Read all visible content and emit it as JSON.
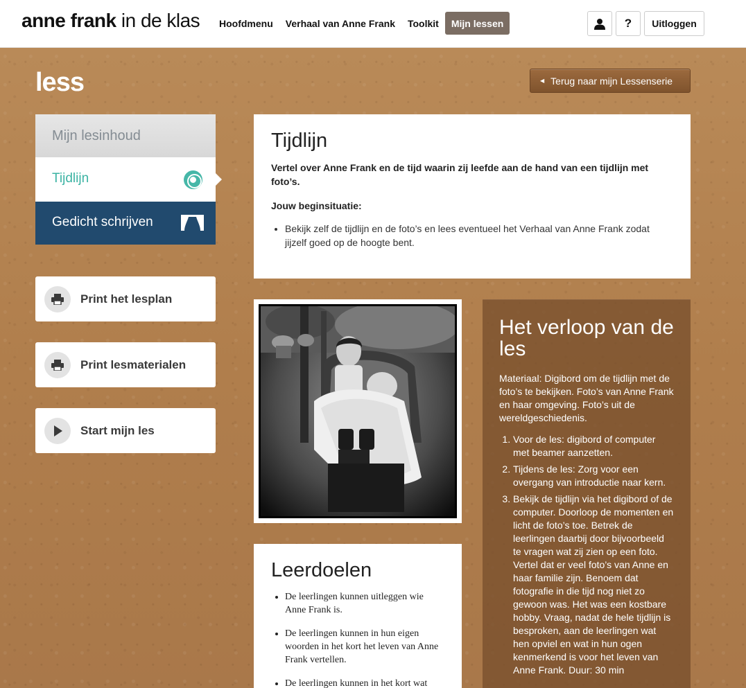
{
  "header": {
    "logo_bold": "anne frank",
    "logo_regular": "in de klas",
    "nav": [
      "Hoofdmenu",
      "Verhaal van Anne Frank",
      "Toolkit",
      "Mijn lessen"
    ],
    "user_icon": "user-icon",
    "help_label": "?",
    "logout_label": "Uitloggen"
  },
  "page": {
    "title": "less",
    "back_label": "Terug naar mijn Lessenserie"
  },
  "sidebar": {
    "heading": "Mijn lesinhoud",
    "items": [
      {
        "label": "Tijdlijn",
        "icon": "target-icon"
      },
      {
        "label": "Gedicht schrijven",
        "icon": "curtain-icon"
      }
    ],
    "actions": [
      {
        "label": "Print het lesplan",
        "icon": "printer-icon"
      },
      {
        "label": "Print lesmaterialen",
        "icon": "printer-icon"
      },
      {
        "label": "Start mijn les",
        "icon": "play-icon"
      }
    ]
  },
  "intro": {
    "title": "Tijdlijn",
    "lead": "Vertel over Anne Frank en de tijd waarin zij leefde aan de hand van een tijdlijn met foto’s.",
    "subheading": "Jouw beginsituatie:",
    "bullets": [
      "Bekijk zelf de tijdlijn en de foto’s en lees eventueel het Verhaal van Anne Frank zodat jijzelf goed op de hoogte bent."
    ]
  },
  "goals": {
    "title": "Leerdoelen",
    "items": [
      "De leerlingen kunnen uitleggen wie Anne Frank is.",
      "De leerlingen kunnen in hun eigen woorden in het kort het leven van Anne Frank vertellen.",
      "De leerlingen kunnen in het kort wat"
    ]
  },
  "course": {
    "title": "Het verloop van de les",
    "material": "Materiaal: Digibord om de tijdlijn met de foto’s te bekijken. Foto’s van Anne Frank en haar omgeving. Foto’s uit de wereldgeschiedenis.",
    "steps": [
      "Voor de les: digibord of computer met beamer aanzetten.",
      "Tijdens de les: Zorg voor een overgang van introductie naar kern.",
      "Bekijk de tijdlijn via het digibord of de computer. Doorloop de momenten en licht de foto’s toe. Betrek de leerlingen daarbij door bijvoorbeeld te vragen wat zij zien op een foto. Vertel dat er veel foto’s van Anne en haar familie zijn. Benoem dat fotografie in die tijd nog niet zo gewoon was. Het was een kostbare hobby. Vraag, nadat de hele tijdlijn is besproken, aan de leerlingen wat hen opviel en wat in hun ogen kenmerkend is voor het leven van Anne Frank. Duur: 30 min"
    ]
  },
  "colors": {
    "accent_teal": "#46b7a8",
    "navy": "#214a6e",
    "cork": "#b07f4e"
  }
}
